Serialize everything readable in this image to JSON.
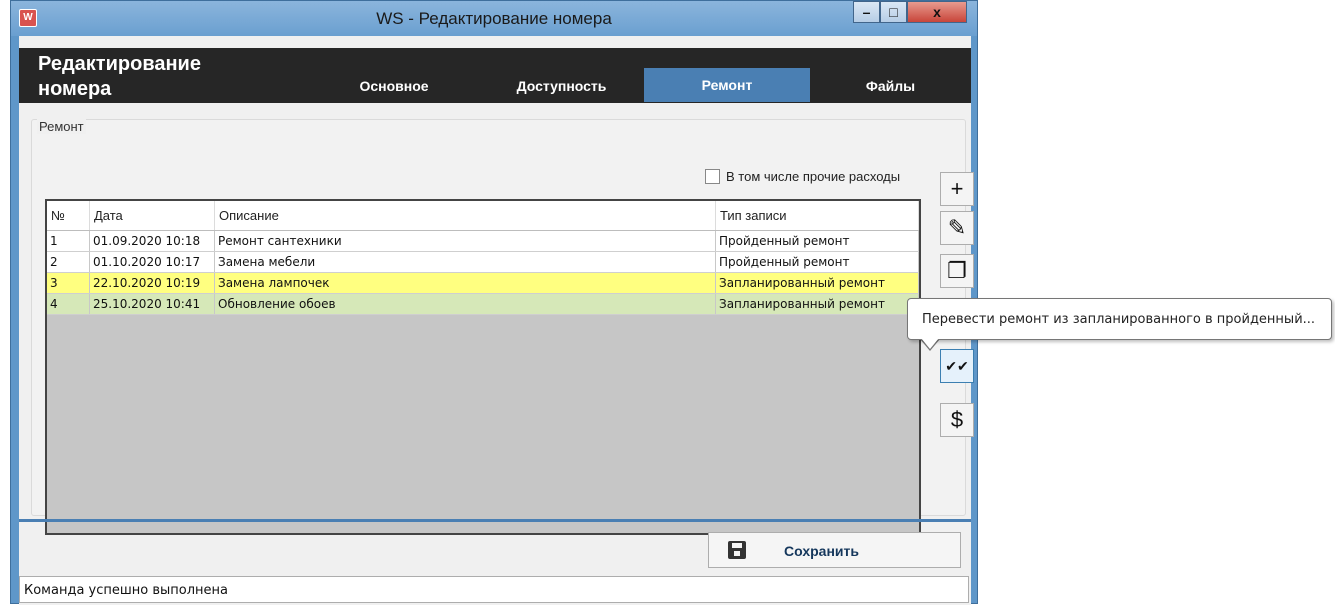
{
  "window": {
    "title": "WS - Редактирование номера",
    "app_icon": "W",
    "controls": {
      "minimize": "–",
      "maximize": "□",
      "close": "x"
    }
  },
  "header": {
    "title": "Редактирование номера",
    "tabs": [
      {
        "label": "Основное",
        "active": false
      },
      {
        "label": "Доступность",
        "active": false
      },
      {
        "label": "Ремонт",
        "active": true
      },
      {
        "label": "Файлы",
        "active": false
      }
    ]
  },
  "repair_group": {
    "label": "Ремонт",
    "include_other_expenses": {
      "label": "В том числе прочие расходы",
      "checked": false
    },
    "table": {
      "columns": [
        "№",
        "Дата",
        "Описание",
        "Тип записи"
      ],
      "rows": [
        {
          "num": "1",
          "date": "01.09.2020 10:18",
          "description": "Ремонт сантехники",
          "type": "Пройденный ремонт",
          "highlight": "#ffffff"
        },
        {
          "num": "2",
          "date": "01.10.2020 10:17",
          "description": "Замена мебели",
          "type": "Пройденный ремонт",
          "highlight": "#ffffff"
        },
        {
          "num": "3",
          "date": "22.10.2020 10:19",
          "description": "Замена лампочек",
          "type": "Запланированный ремонт",
          "highlight": "#ffff80"
        },
        {
          "num": "4",
          "date": "25.10.2020 10:41",
          "description": "Обновление обоев",
          "type": "Запланированный ремонт",
          "highlight": "#d6e8b8"
        }
      ]
    },
    "side_buttons": [
      {
        "icon": "plus-icon",
        "glyph": "+"
      },
      {
        "icon": "pencil-icon",
        "glyph": "✎"
      },
      {
        "icon": "copy-icon",
        "glyph": "❐"
      },
      {
        "icon": "double-check-icon",
        "glyph": "✔✔"
      },
      {
        "icon": "dollar-icon",
        "glyph": "$"
      }
    ]
  },
  "tooltip": {
    "text": "Перевести ремонт из запланированного в пройденный..."
  },
  "footer": {
    "save_label": "Сохранить",
    "status": "Команда успешно выполнена"
  },
  "colors": {
    "accent": "#4a7fb3",
    "header_bg": "#262626",
    "planned_row": "#ffff80",
    "planned_row_alt": "#d6e8b8"
  }
}
